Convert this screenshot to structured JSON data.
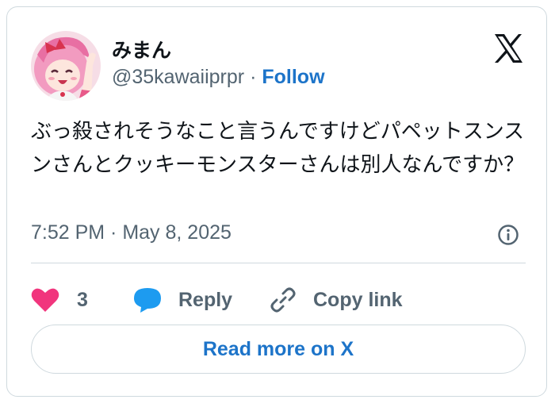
{
  "author": {
    "display_name": "みまん",
    "handle": "@35kawaiiprpr",
    "separator": "·",
    "follow_label": "Follow",
    "avatar_icon": "anime-girl-avatar"
  },
  "brand": {
    "logo_icon": "x-logo-icon"
  },
  "tweet": {
    "text": "ぶっ殺されそうなこと言うんですけどパペットスンスンさんとクッキーモンスターさんは別人なんですか？",
    "timestamp": "7:52 PM · May 8, 2025",
    "info_icon": "info-icon"
  },
  "actions": {
    "like_count": "3",
    "reply_label": "Reply",
    "copy_label": "Copy link"
  },
  "footer": {
    "read_more_label": "Read more on X"
  },
  "colors": {
    "accent": "#1d74c9",
    "heart": "#f1357d",
    "reply_bubble": "#1d9bf0",
    "muted": "#536471",
    "text": "#0f1419",
    "border": "#cfd9de"
  }
}
